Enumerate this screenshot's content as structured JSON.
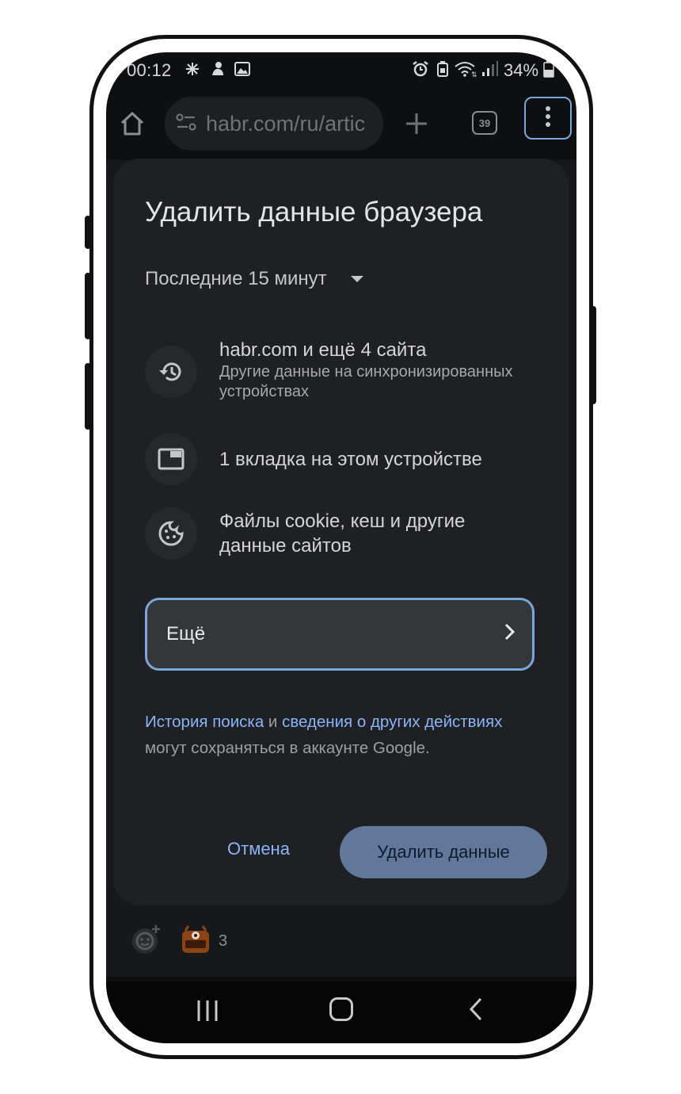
{
  "status_bar": {
    "time": "00:12",
    "battery": "34%",
    "left_icons": [
      "brightness-icon",
      "notification-icon",
      "gallery-icon"
    ],
    "right_icons": [
      "alarm-icon",
      "battery-saver-icon",
      "wifi-icon",
      "signal-icon",
      "battery-icon"
    ]
  },
  "toolbar": {
    "url": "habr.com/ru/artic",
    "tab_count": "39"
  },
  "dialog": {
    "title": "Удалить данные браузера",
    "time_range": "Последние 15 минут",
    "items": [
      {
        "icon": "history-icon",
        "title": "habr.com и ещё 4 сайта",
        "subtitle": "Другие данные на синхронизированных устройствах"
      },
      {
        "icon": "tab-icon",
        "title": "1 вкладка на этом устройстве"
      },
      {
        "icon": "cookie-icon",
        "title": "Файлы cookie, кеш и другие данные сайтов"
      }
    ],
    "more_label": "Ещё",
    "note": {
      "link1": "История поиска",
      "and": " и ",
      "link2": "сведения о других действиях",
      "rest": " могут сохраняться в аккаунте Google."
    },
    "cancel_label": "Отмена",
    "delete_label": "Удалить данные"
  },
  "reactions": {
    "count": "3"
  },
  "colors": {
    "accent": "#8ab4f8",
    "dialog_bg": "#1f2023",
    "primary_button": "#61789b",
    "focus_ring": "#7aa6d8"
  }
}
